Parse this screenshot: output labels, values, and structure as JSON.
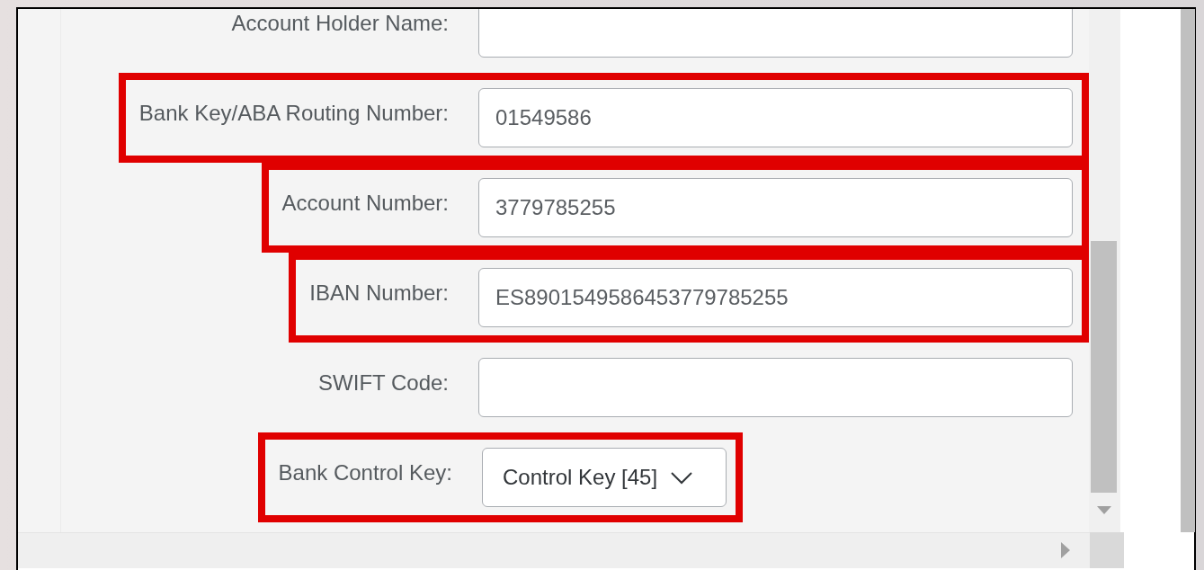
{
  "form": {
    "fields": [
      {
        "label": "Account Holder Name:",
        "kind": "input",
        "highlighted": false
      },
      {
        "label": "Bank Key/ABA Routing Number:",
        "kind": "input",
        "value": "01549586",
        "highlighted": true
      },
      {
        "label": "Account Number:",
        "kind": "input",
        "value": "3779785255",
        "highlighted": true
      },
      {
        "label": "IBAN Number:",
        "kind": "input",
        "value": "ES8901549586453779785255",
        "highlighted": true
      },
      {
        "label": "SWIFT Code:",
        "kind": "input",
        "highlighted": false
      },
      {
        "label": "Bank Control Key:",
        "kind": "select",
        "value": "Control Key [45]",
        "highlighted": true
      }
    ]
  }
}
